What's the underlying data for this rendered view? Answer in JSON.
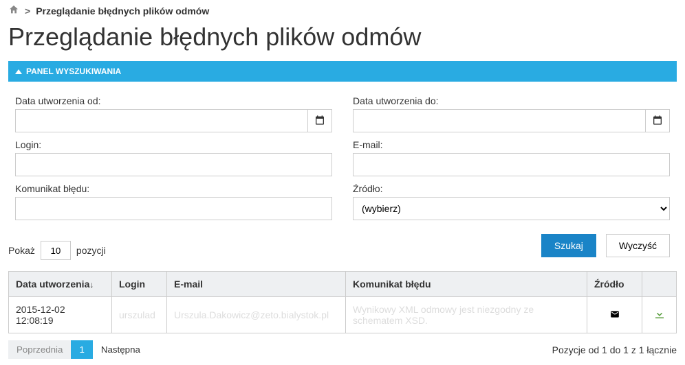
{
  "breadcrumb": {
    "current": "Przeglądanie błędnych plików odmów"
  },
  "page_title": "Przeglądanie błędnych plików odmów",
  "panel": {
    "title": "PANEL WYSZUKIWANIA"
  },
  "form": {
    "date_from_label": "Data utworzenia od:",
    "date_from_value": "",
    "date_to_label": "Data utworzenia do:",
    "date_to_value": "",
    "login_label": "Login:",
    "login_value": "",
    "email_label": "E-mail:",
    "email_value": "",
    "error_label": "Komunikat błędu:",
    "error_value": "",
    "source_label": "Źródło:",
    "source_placeholder": "(wybierz)"
  },
  "buttons": {
    "search": "Szukaj",
    "clear": "Wyczyść"
  },
  "page_size": {
    "show_label": "Pokaż",
    "value": "10",
    "suffix": "pozycji"
  },
  "table": {
    "headers": {
      "created": "Data utworzenia",
      "sort_indicator": "↓",
      "login": "Login",
      "email": "E-mail",
      "error": "Komunikat błędu",
      "source": "Źródło"
    },
    "rows": [
      {
        "created": "2015-12-02 12:08:19",
        "login": "urszulad",
        "email": "Urszula.Dakowicz@zeto.bialystok.pl",
        "error": "Wynikowy XML odmowy jest niezgodny ze schematem XSD."
      }
    ]
  },
  "pager": {
    "prev": "Poprzednia",
    "page": "1",
    "next": "Następna"
  },
  "footer": {
    "summary": "Pozycje od 1 do 1 z 1 łącznie"
  }
}
